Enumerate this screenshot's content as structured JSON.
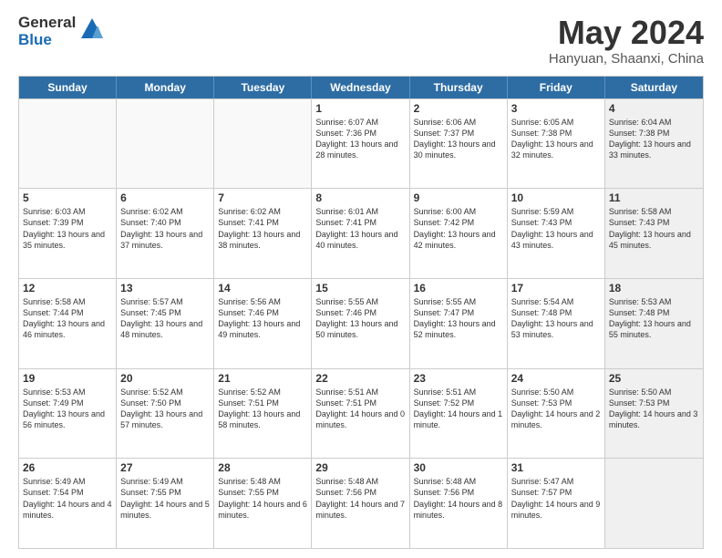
{
  "logo": {
    "line1": "General",
    "line2": "Blue"
  },
  "title": "May 2024",
  "subtitle": "Hanyuan, Shaanxi, China",
  "headers": [
    "Sunday",
    "Monday",
    "Tuesday",
    "Wednesday",
    "Thursday",
    "Friday",
    "Saturday"
  ],
  "weeks": [
    [
      {
        "day": "",
        "text": "",
        "empty": true
      },
      {
        "day": "",
        "text": "",
        "empty": true
      },
      {
        "day": "",
        "text": "",
        "empty": true
      },
      {
        "day": "1",
        "text": "Sunrise: 6:07 AM\nSunset: 7:36 PM\nDaylight: 13 hours\nand 28 minutes."
      },
      {
        "day": "2",
        "text": "Sunrise: 6:06 AM\nSunset: 7:37 PM\nDaylight: 13 hours\nand 30 minutes."
      },
      {
        "day": "3",
        "text": "Sunrise: 6:05 AM\nSunset: 7:38 PM\nDaylight: 13 hours\nand 32 minutes."
      },
      {
        "day": "4",
        "text": "Sunrise: 6:04 AM\nSunset: 7:38 PM\nDaylight: 13 hours\nand 33 minutes.",
        "shaded": true
      }
    ],
    [
      {
        "day": "5",
        "text": "Sunrise: 6:03 AM\nSunset: 7:39 PM\nDaylight: 13 hours\nand 35 minutes."
      },
      {
        "day": "6",
        "text": "Sunrise: 6:02 AM\nSunset: 7:40 PM\nDaylight: 13 hours\nand 37 minutes."
      },
      {
        "day": "7",
        "text": "Sunrise: 6:02 AM\nSunset: 7:41 PM\nDaylight: 13 hours\nand 38 minutes."
      },
      {
        "day": "8",
        "text": "Sunrise: 6:01 AM\nSunset: 7:41 PM\nDaylight: 13 hours\nand 40 minutes."
      },
      {
        "day": "9",
        "text": "Sunrise: 6:00 AM\nSunset: 7:42 PM\nDaylight: 13 hours\nand 42 minutes."
      },
      {
        "day": "10",
        "text": "Sunrise: 5:59 AM\nSunset: 7:43 PM\nDaylight: 13 hours\nand 43 minutes."
      },
      {
        "day": "11",
        "text": "Sunrise: 5:58 AM\nSunset: 7:43 PM\nDaylight: 13 hours\nand 45 minutes.",
        "shaded": true
      }
    ],
    [
      {
        "day": "12",
        "text": "Sunrise: 5:58 AM\nSunset: 7:44 PM\nDaylight: 13 hours\nand 46 minutes."
      },
      {
        "day": "13",
        "text": "Sunrise: 5:57 AM\nSunset: 7:45 PM\nDaylight: 13 hours\nand 48 minutes."
      },
      {
        "day": "14",
        "text": "Sunrise: 5:56 AM\nSunset: 7:46 PM\nDaylight: 13 hours\nand 49 minutes."
      },
      {
        "day": "15",
        "text": "Sunrise: 5:55 AM\nSunset: 7:46 PM\nDaylight: 13 hours\nand 50 minutes."
      },
      {
        "day": "16",
        "text": "Sunrise: 5:55 AM\nSunset: 7:47 PM\nDaylight: 13 hours\nand 52 minutes."
      },
      {
        "day": "17",
        "text": "Sunrise: 5:54 AM\nSunset: 7:48 PM\nDaylight: 13 hours\nand 53 minutes."
      },
      {
        "day": "18",
        "text": "Sunrise: 5:53 AM\nSunset: 7:48 PM\nDaylight: 13 hours\nand 55 minutes.",
        "shaded": true
      }
    ],
    [
      {
        "day": "19",
        "text": "Sunrise: 5:53 AM\nSunset: 7:49 PM\nDaylight: 13 hours\nand 56 minutes."
      },
      {
        "day": "20",
        "text": "Sunrise: 5:52 AM\nSunset: 7:50 PM\nDaylight: 13 hours\nand 57 minutes."
      },
      {
        "day": "21",
        "text": "Sunrise: 5:52 AM\nSunset: 7:51 PM\nDaylight: 13 hours\nand 58 minutes."
      },
      {
        "day": "22",
        "text": "Sunrise: 5:51 AM\nSunset: 7:51 PM\nDaylight: 14 hours\nand 0 minutes."
      },
      {
        "day": "23",
        "text": "Sunrise: 5:51 AM\nSunset: 7:52 PM\nDaylight: 14 hours\nand 1 minute."
      },
      {
        "day": "24",
        "text": "Sunrise: 5:50 AM\nSunset: 7:53 PM\nDaylight: 14 hours\nand 2 minutes."
      },
      {
        "day": "25",
        "text": "Sunrise: 5:50 AM\nSunset: 7:53 PM\nDaylight: 14 hours\nand 3 minutes.",
        "shaded": true
      }
    ],
    [
      {
        "day": "26",
        "text": "Sunrise: 5:49 AM\nSunset: 7:54 PM\nDaylight: 14 hours\nand 4 minutes."
      },
      {
        "day": "27",
        "text": "Sunrise: 5:49 AM\nSunset: 7:55 PM\nDaylight: 14 hours\nand 5 minutes."
      },
      {
        "day": "28",
        "text": "Sunrise: 5:48 AM\nSunset: 7:55 PM\nDaylight: 14 hours\nand 6 minutes."
      },
      {
        "day": "29",
        "text": "Sunrise: 5:48 AM\nSunset: 7:56 PM\nDaylight: 14 hours\nand 7 minutes."
      },
      {
        "day": "30",
        "text": "Sunrise: 5:48 AM\nSunset: 7:56 PM\nDaylight: 14 hours\nand 8 minutes."
      },
      {
        "day": "31",
        "text": "Sunrise: 5:47 AM\nSunset: 7:57 PM\nDaylight: 14 hours\nand 9 minutes."
      },
      {
        "day": "",
        "text": "",
        "empty": true,
        "shaded": true
      }
    ]
  ]
}
